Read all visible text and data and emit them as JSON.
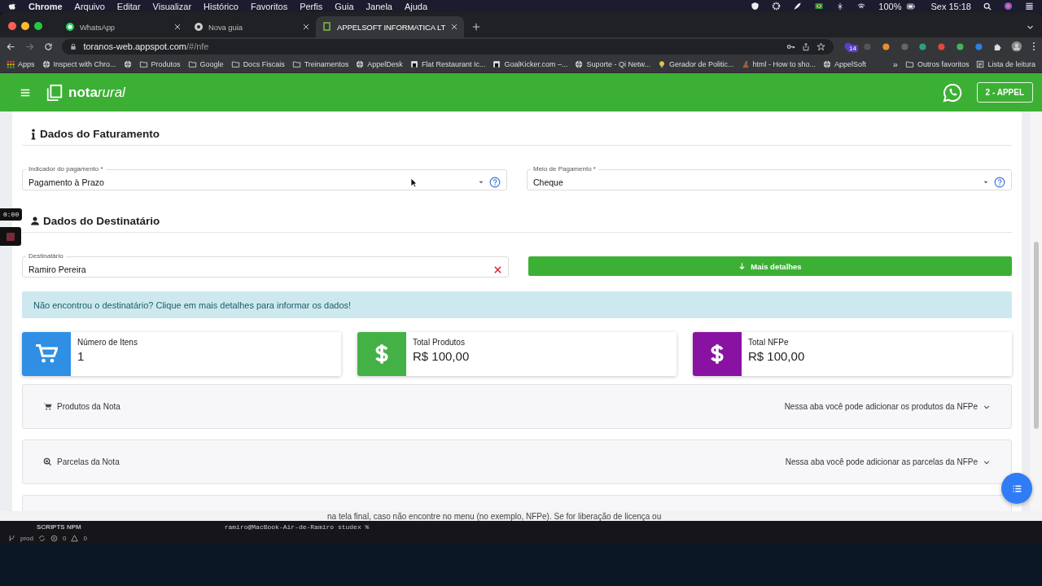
{
  "menubar": {
    "app": "Chrome",
    "items": [
      "Arquivo",
      "Editar",
      "Visualizar",
      "Histórico",
      "Favoritos",
      "Perfis",
      "Guia",
      "Janela",
      "Ajuda"
    ],
    "battery": "100%",
    "clock": "Sex 15:18"
  },
  "browser": {
    "tabs": [
      {
        "title": "WhatsApp",
        "kind": "whatsapp",
        "selected": false
      },
      {
        "title": "Nova guia",
        "kind": "chrome",
        "selected": false
      },
      {
        "title": "APPELSOFT INFORMATICA LT",
        "kind": "site",
        "selected": true
      }
    ],
    "url_host": "toranos-web.appspot.com",
    "url_path": "/#/nfe",
    "extension_badge": "14",
    "bookmarks": [
      {
        "label": "Apps",
        "kind": "apps"
      },
      {
        "label": "Inspect with Chro...",
        "kind": "globe"
      },
      {
        "kind": "globe"
      },
      {
        "label": "Produtos",
        "kind": "folder"
      },
      {
        "label": "Google",
        "kind": "folder"
      },
      {
        "label": "Docs Fiscais",
        "kind": "folder"
      },
      {
        "label": "Treinamentos",
        "kind": "folder"
      },
      {
        "label": "AppelDesk",
        "kind": "globe"
      },
      {
        "label": "Flat Restaurant Ic...",
        "kind": "site"
      },
      {
        "label": "GoalKicker.com –...",
        "kind": "site"
      },
      {
        "label": "Suporte - Qi Netw...",
        "kind": "globe"
      },
      {
        "label": "Gerador de Politic...",
        "kind": "bulb"
      },
      {
        "label": "html - How to sho...",
        "kind": "stack"
      },
      {
        "label": "AppelSoft",
        "kind": "globe"
      }
    ],
    "more": "»",
    "other_bookmarks": "Outros favoritos",
    "reading_list": "Lista de leitura"
  },
  "app": {
    "logo_bold": "nota",
    "logo_light": "rural",
    "account": "2 - APPEL",
    "billing_title": "Dados do Faturamento",
    "billing_fields": [
      {
        "label": "Indicador do pagamento *",
        "value": "Pagamento à Prazo"
      },
      {
        "label": "Meio de Pagamento *",
        "value": "Cheque"
      }
    ],
    "recipient_title": "Dados do Destinatário",
    "recipient_field": {
      "label": "Destinatário",
      "value": "Ramiro Pereira"
    },
    "details_button": "Mais detalhes",
    "alert": "Não encontrou o destinatário? Clique em mais detalhes para informar os dados!",
    "stats": [
      {
        "label": "Número de Itens",
        "value": "1",
        "kind": "cart",
        "color": "#2e8fe5"
      },
      {
        "label": "Total Produtos",
        "value": "R$ 100,00",
        "kind": "dollar",
        "color": "#43b146"
      },
      {
        "label": "Total NFPe",
        "value": "R$ 100,00",
        "kind": "dollar",
        "color": "#8a12a3"
      }
    ],
    "panels": [
      {
        "title": "Produtos da Nota",
        "hint": "Nessa aba você pode adicionar os produtos da NFPe",
        "kind": "cart",
        "expanded": false
      },
      {
        "title": "Parcelas da Nota",
        "hint": "Nessa aba você pode adicionar as parcelas da NFPe",
        "kind": "search",
        "expanded": false
      }
    ]
  },
  "recorder": {
    "time": "0:00"
  },
  "background_text": "na tela final, caso não encontre no menu (no exemplo, NFPe). Se for liberação de licença ou",
  "terminal": {
    "section": "SCRIPTS NPM",
    "prompt": "ramiro@MacBook-Air-de-Ramiro studex % ",
    "branch": "prod",
    "errors": "0",
    "warnings": "0"
  }
}
